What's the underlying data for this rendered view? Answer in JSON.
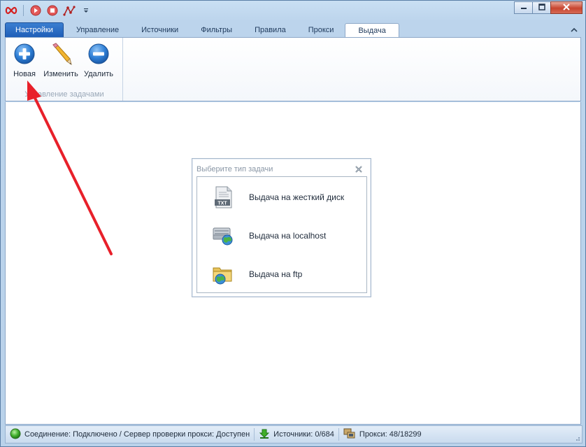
{
  "window": {
    "title": "",
    "controls": {
      "minimize": "minimize-icon",
      "maximize": "maximize-icon",
      "close": "close-icon"
    }
  },
  "quick_access": {
    "icons": [
      "infinity-logo-icon",
      "play-icon",
      "stop-icon",
      "graph-icon",
      "qat-dropdown-icon"
    ]
  },
  "tabs": [
    {
      "label": "Настройки",
      "type": "app"
    },
    {
      "label": "Управление"
    },
    {
      "label": "Источники"
    },
    {
      "label": "Фильтры"
    },
    {
      "label": "Правила"
    },
    {
      "label": "Прокси"
    },
    {
      "label": "Выдача",
      "active": true
    }
  ],
  "ribbon": {
    "group_label": "Управление задачами",
    "buttons": [
      {
        "label": "Новая",
        "icon": "add-icon"
      },
      {
        "label": "Изменить",
        "icon": "pencil-icon"
      },
      {
        "label": "Удалить",
        "icon": "remove-icon"
      }
    ]
  },
  "dialog": {
    "title": "Выберите тип задачи",
    "options": [
      {
        "label": "Выдача на жесткий диск",
        "icon": "txt-file-icon",
        "icon_text": "TXT"
      },
      {
        "label": "Выдача на localhost",
        "icon": "server-globe-icon"
      },
      {
        "label": "Выдача на ftp",
        "icon": "folder-globe-icon"
      }
    ]
  },
  "annotation": {
    "color": "#e8202a"
  },
  "status": {
    "connection": "Соединение: Подключено / Сервер проверки прокси: Доступен",
    "sources": "Источники: 0/684",
    "proxies": "Прокси: 48/18299"
  },
  "colors": {
    "accent_blue": "#1f5fb8",
    "status_ok": "#3fae2a"
  }
}
